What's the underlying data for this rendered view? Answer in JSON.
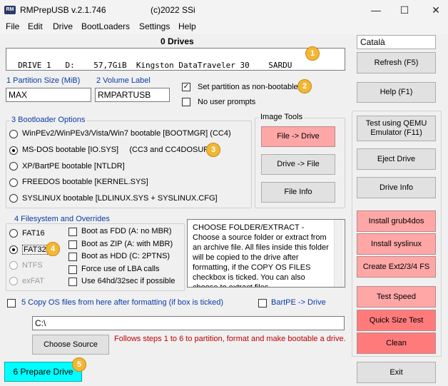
{
  "window": {
    "app_abbrev": "RM",
    "title": "RMPrepUSB v.2.1.746",
    "copyright": "(c)2022 SSi",
    "minimize": "—",
    "maximize": "☐",
    "close": "✕"
  },
  "menu": [
    "File",
    "Edit",
    "Drive",
    "BootLoaders",
    "Settings",
    "Help"
  ],
  "drives": {
    "count_label": "0 Drives",
    "list_item": "DRIVE 1   D:    57,7GiB  Kingston DataTraveler 30    SARDU"
  },
  "language": "Català",
  "right_buttons": {
    "refresh": "Refresh (F5)",
    "help": "Help (F1)",
    "qemu": "Test using QEMU Emulator (F11)",
    "eject": "Eject Drive",
    "drive_info": "Drive Info",
    "install_grub4dos": "Install grub4dos",
    "install_syslinux": "Install syslinux",
    "create_ext": "Create Ext2/3/4 FS",
    "test_speed": "Test Speed",
    "quick_size_test": "Quick Size Test",
    "clean": "Clean",
    "exit": "Exit"
  },
  "partition": {
    "size_label": "1 Partition Size (MiB)",
    "size_value": "MAX",
    "volume_label": "2 Volume Label",
    "volume_value": "RMPARTUSB",
    "non_bootable_label": "Set partition as non-bootable",
    "non_bootable_checked": "✓",
    "no_prompts_label": "No user prompts"
  },
  "bootloader": {
    "title": "3 Bootloader Options",
    "options": [
      "WinPEv2/WinPEv3/Vista/Win7 bootable [BOOTMGR] (CC4)",
      "MS-DOS bootable [IO.SYS]     (CC3 and CC4DOSUFD)",
      "XP/BartPE bootable [NTLDR]",
      "FREEDOS bootable [KERNEL.SYS]",
      "SYSLINUX bootable [LDLINUX.SYS + SYSLINUX.CFG]"
    ]
  },
  "image_tools": {
    "title": "Image Tools",
    "file_to_drive": "File -> Drive",
    "drive_to_file": "Drive -> File",
    "file_info": "File Info"
  },
  "filesystem": {
    "title": "4 Filesystem and Overrides",
    "options": [
      "FAT16",
      "FAT32",
      "NTFS",
      "exFAT"
    ],
    "overrides": [
      "Boot as FDD (A: no MBR)",
      "Boot as ZIP (A: with MBR)",
      "Boot as HDD (C: 2PTNS)",
      "Force use of LBA calls",
      "Use 64hd/32sec if possible"
    ]
  },
  "info_text": "CHOOSE FOLDER/EXTRACT - Choose a source folder or extract from an archive file. All files inside this folder will be copied to the drive after formatting, if the COPY OS FILES checkbox is ticked. You can also choose to extract files",
  "copy_os": {
    "label": "5 Copy OS files from here after formatting (if box is ticked)",
    "bartpe_label": "BartPE -> Drive",
    "path": "C:\\",
    "choose_source": "Choose Source",
    "hint": "Follows steps 1 to 6 to partition, format and make bootable a drive."
  },
  "prepare_drive": "6 Prepare Drive",
  "markers": [
    "1",
    "2",
    "3",
    "4",
    "5"
  ]
}
